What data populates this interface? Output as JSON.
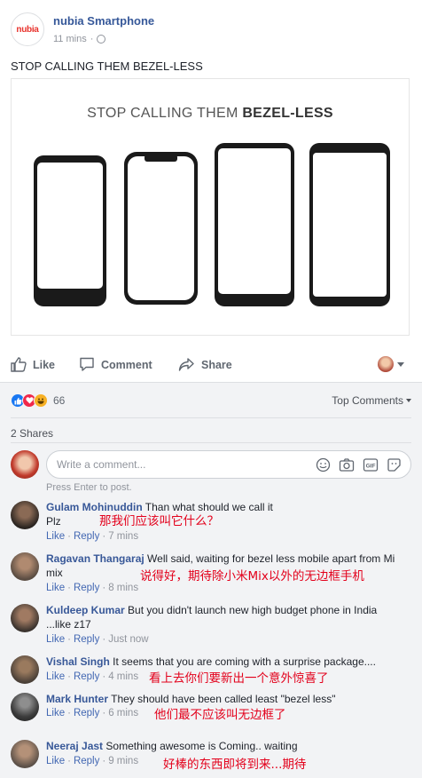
{
  "post": {
    "page_logo_text": "nubia",
    "page_name": "nubia Smartphone",
    "time": "11 mins",
    "separator": "·",
    "text": "STOP CALLING THEM BEZEL-LESS",
    "image_title_plain": "STOP CALLING THEM ",
    "image_title_bold": "BEZEL-LESS"
  },
  "actions": {
    "like": "Like",
    "comment": "Comment",
    "share": "Share"
  },
  "engagement": {
    "reaction_count": "66",
    "top_comments": "Top Comments",
    "shares": "2 Shares"
  },
  "composer": {
    "placeholder": "Write a comment...",
    "hint": "Press Enter to post."
  },
  "comments": [
    {
      "name": "Gulam Mohinuddin",
      "text": "Than what should we call it",
      "text2": "Plz",
      "like": "Like",
      "reply": "Reply",
      "time": "7 mins",
      "translation": "那我们应该叫它什么？"
    },
    {
      "name": "Ragavan Thangaraj",
      "text": "Well said, waiting for bezel less mobile apart from Mi",
      "text2": "mix",
      "like": "Like",
      "reply": "Reply",
      "time": "8 mins",
      "translation": "说得好，期待除小米Mix以外的无边框手机"
    },
    {
      "name": "Kuldeep Kumar",
      "text": "But you didn't launch new high budget phone in India",
      "text2": "...like z17",
      "like": "Like",
      "reply": "Reply",
      "time": "Just now",
      "translation": ""
    },
    {
      "name": "Vishal Singh",
      "text": "It seems that you are coming with a surprise package....",
      "text2": "",
      "like": "Like",
      "reply": "Reply",
      "time": "4 mins",
      "translation": "看上去你们要新出一个意外惊喜了"
    },
    {
      "name": "Mark Hunter",
      "text": "They should have been called least \"bezel less\"",
      "text2": "",
      "like": "Like",
      "reply": "Reply",
      "time": "6 mins",
      "translation": "他们最不应该叫无边框了"
    },
    {
      "name": "Neeraj Jast",
      "text": "Something awesome is Coming.. waiting",
      "text2": "",
      "like": "Like",
      "reply": "Reply",
      "time": "9 mins",
      "translation": "好棒的东西即将到来...期待"
    }
  ],
  "colors": {
    "link": "#385898",
    "annotation": "#e3001b",
    "background_comments": "#f2f3f5"
  }
}
